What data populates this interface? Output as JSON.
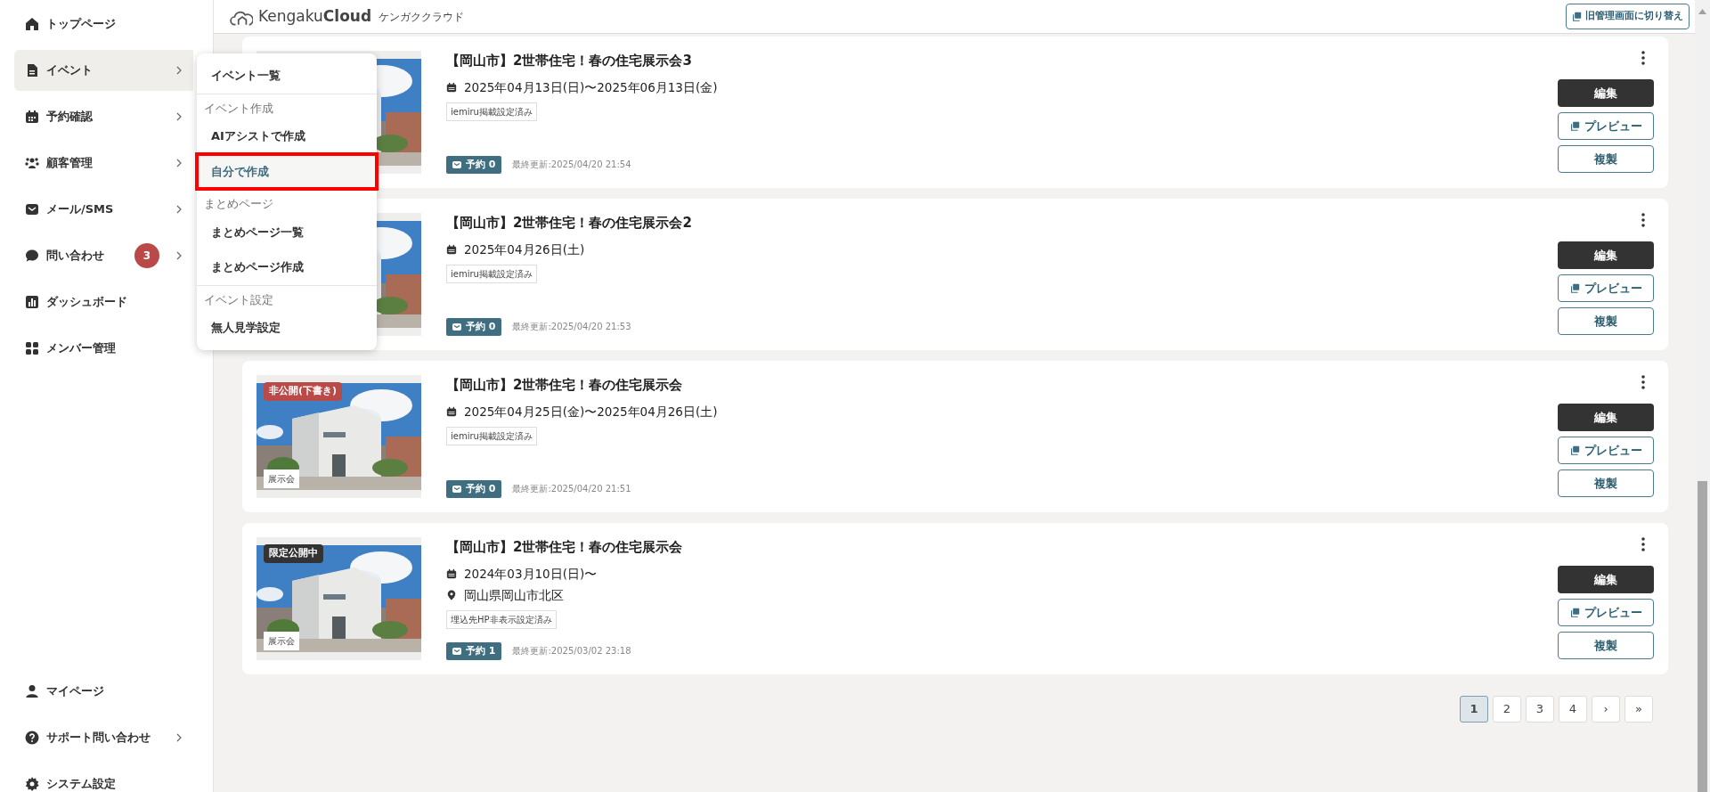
{
  "sidebar": {
    "items": [
      {
        "label": "トップページ",
        "submenu": false,
        "selected": false
      },
      {
        "label": "イベント",
        "submenu": true,
        "selected": true
      },
      {
        "label": "予約確認",
        "submenu": true,
        "selected": false
      },
      {
        "label": "顧客管理",
        "submenu": true,
        "selected": false
      },
      {
        "label": "メール/SMS",
        "submenu": true,
        "selected": false
      },
      {
        "label": "問い合わせ",
        "submenu": true,
        "selected": false,
        "badge": "3"
      },
      {
        "label": "ダッシュボード",
        "submenu": false,
        "selected": false
      },
      {
        "label": "メンバー管理",
        "submenu": false,
        "selected": false
      }
    ],
    "bottom_items": [
      {
        "label": "マイページ",
        "submenu": false,
        "selected": false
      },
      {
        "label": "サポート問い合わせ",
        "submenu": true,
        "selected": false
      },
      {
        "label": "システム設定",
        "submenu": false,
        "selected": false
      }
    ]
  },
  "header": {
    "logo": "Kengaku**Cloud**",
    "logo_kana": "ケンガククラウド",
    "switch_button": "旧管理画面に切り替え"
  },
  "event_menu": {
    "groups": [
      {
        "items": [
          {
            "label": "イベント一覧",
            "selected": false,
            "highlighted": false
          }
        ]
      },
      {
        "heading": "イベント作成",
        "items": [
          {
            "label": "AIアシストで作成",
            "selected": false,
            "highlighted": false
          },
          {
            "label": "自分で作成",
            "selected": true,
            "highlighted": true
          }
        ]
      },
      {
        "heading": "まとめページ",
        "items": [
          {
            "label": "まとめページ一覧",
            "selected": false,
            "highlighted": false
          },
          {
            "label": "まとめページ作成",
            "selected": false,
            "highlighted": false
          }
        ]
      },
      {
        "heading": "イベント設定",
        "items": [
          {
            "label": "無人見学設定",
            "selected": false,
            "highlighted": false
          }
        ]
      }
    ]
  },
  "events": [
    {
      "image": {
        "kind": "picture"
      },
      "title": "【岡山市】2世帯住宅！春の住宅展示会3",
      "details": [
        {
          "kind": "date",
          "text": "2025年04月13日(日)〜2025年06月13日(金)"
        }
      ],
      "tag": "iemiru掲載設定済み",
      "reservations": "予約 0",
      "updated": "最終更新:2025/04/20 21:54",
      "actions": [
        "編集",
        "プレビュー",
        "複製"
      ]
    },
    {
      "image": {
        "kind": "picture"
      },
      "title": "【岡山市】2世帯住宅！春の住宅展示会2",
      "details": [
        {
          "kind": "date",
          "text": "2025年04月26日(土)"
        }
      ],
      "tag": "iemiru掲載設定済み",
      "reservations": "予約 0",
      "updated": "最終更新:2025/04/20 21:53",
      "actions": [
        "編集",
        "プレビュー",
        "複製"
      ]
    },
    {
      "image": {
        "kind": "picture"
      },
      "status": {
        "text": "非公開(下書き)",
        "color": "#b94a48"
      },
      "category": "展示会",
      "title": "【岡山市】2世帯住宅！春の住宅展示会",
      "details": [
        {
          "kind": "date",
          "text": "2025年04月25日(金)〜2025年04月26日(土)"
        }
      ],
      "tag": "iemiru掲載設定済み",
      "reservations": "予約 0",
      "updated": "最終更新:2025/04/20 21:51",
      "actions": [
        "編集",
        "プレビュー",
        "複製"
      ]
    },
    {
      "image": {
        "kind": "picture"
      },
      "status": {
        "text": "限定公開中",
        "color": "#333333"
      },
      "category": "展示会",
      "title": "【岡山市】2世帯住宅！春の住宅展示会",
      "details": [
        {
          "kind": "date",
          "text": "2024年03月10日(日)〜"
        },
        {
          "kind": "location",
          "text": "岡山県岡山市北区"
        }
      ],
      "tag": "埋込先HP非表示設定済み",
      "reservations": "予約 1",
      "updated": "最終更新:2025/03/02 23:18",
      "actions": [
        "編集",
        "プレビュー",
        "複製"
      ]
    }
  ],
  "pagination": [
    {
      "label": "1",
      "selected": true
    },
    {
      "label": "2",
      "selected": false
    },
    {
      "label": "3",
      "selected": false
    },
    {
      "label": "4",
      "selected": false
    },
    {
      "label": "›",
      "selected": false
    },
    {
      "label": "»",
      "selected": false
    }
  ]
}
